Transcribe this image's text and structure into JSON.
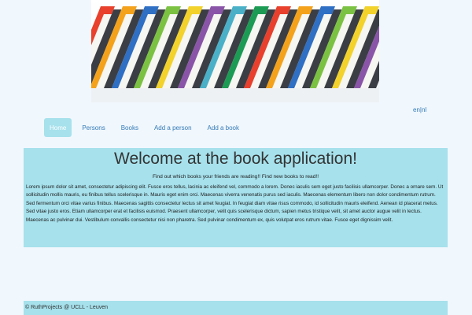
{
  "banner": {
    "image": "colorful-books-banner"
  },
  "language": {
    "en_label": "en",
    "separator": "|",
    "nl_label": "nl"
  },
  "nav": {
    "items": [
      {
        "label": "Home",
        "active": true
      },
      {
        "label": "Persons",
        "active": false
      },
      {
        "label": "Books",
        "active": false
      },
      {
        "label": "Add a person",
        "active": false
      },
      {
        "label": "Add a book",
        "active": false
      }
    ]
  },
  "main": {
    "title": "Welcome at the book application!",
    "subtitle": "Find out which books your friends are reading!! Find new books to read!!",
    "body": "Lorem ipsum dolor sit amet, consectetur adipiscing elit. Fusce eros tellus, lacinia ac eleifend vel, commodo a lorem. Donec iaculis sem eget justo facilisis ullamcorper. Donec a ornare sem. Ut sollicitudin mollis mauris, eu finibus tellus scelerisque in. Mauris eget enim orci. Maecenas viverra venenatis purus sed iaculis. Maecenas elementum libero non dolor condimentum rutrum. Sed fermentum orci vitae varius finibus. Maecenas sagittis consectetur lectus sit amet feugiat. In feugiat diam vitae risus commodo, id sollicitudin mauris eleifend. Aenean id placerat metus. Sed vitae justo eros. Etiam ullamcorper erat et facilisis euismod. Praesent ullamcorper, velit quis scelerisque dictum, sapien metus tristique velit, sit amet auctor augue velit in lectus. Maecenas ac pulvinar dui. Vestibulum convallis consectetur nisi non pharetra. Sed pulvinar condimentum ex, quis volutpat eros rutrum vitae. Fusce eget dignissim velit."
  },
  "footer": {
    "text": "© RuthProjects @ UCLL - Leuven"
  },
  "colors": {
    "page_bg": "#f0f7fd",
    "panel_bg": "#a6e1ec",
    "link": "#337ab7",
    "book_colors": [
      "#e8402c",
      "#f4a21b",
      "#2f6fc4",
      "#7cc242",
      "#f2d22b",
      "#8a55a8",
      "#4ab0c8",
      "#1c9b54"
    ]
  }
}
